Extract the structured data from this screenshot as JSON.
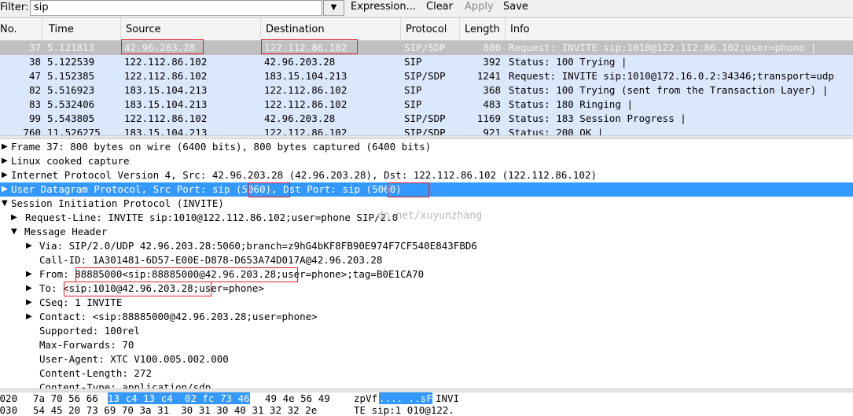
{
  "filter": {
    "label": "Filter:",
    "value": "sip",
    "expression_label": "Expression...",
    "clear_label": "Clear",
    "apply_label": "Apply",
    "save_label": "Save"
  },
  "columns": [
    "No.",
    "Time",
    "Source",
    "Destination",
    "Protocol",
    "Length",
    "Info"
  ],
  "packets": [
    {
      "no": "37",
      "time": "5.121813",
      "source": "42.96.203.28",
      "destination": "122.112.86.102",
      "protocol": "SIP/SDP",
      "length": "800",
      "info": "Request: INVITE sip:1010@122.112.86.102;user=phone |"
    },
    {
      "no": "38",
      "time": "5.122539",
      "source": "122.112.86.102",
      "destination": "42.96.203.28",
      "protocol": "SIP",
      "length": "392",
      "info": "Status: 100 Trying |"
    },
    {
      "no": "47",
      "time": "5.152385",
      "source": "122.112.86.102",
      "destination": "183.15.104.213",
      "protocol": "SIP/SDP",
      "length": "1241",
      "info": "Request: INVITE sip:1010@172.16.0.2:34346;transport=udp"
    },
    {
      "no": "82",
      "time": "5.516923",
      "source": "183.15.104.213",
      "destination": "122.112.86.102",
      "protocol": "SIP",
      "length": "368",
      "info": "Status: 100 Trying (sent from the Transaction Layer) |"
    },
    {
      "no": "83",
      "time": "5.532406",
      "source": "183.15.104.213",
      "destination": "122.112.86.102",
      "protocol": "SIP",
      "length": "483",
      "info": "Status: 180 Ringing |"
    },
    {
      "no": "99",
      "time": "5.543805",
      "source": "122.112.86.102",
      "destination": "42.96.203.28",
      "protocol": "SIP/SDP",
      "length": "1169",
      "info": "Status: 183 Session Progress |"
    },
    {
      "no": "760",
      "time": "11.526275",
      "source": "183.15.104.213",
      "destination": "122.112.86.102",
      "protocol": "SIP/SDP",
      "length": "921",
      "info": "Status: 200 OK |"
    }
  ],
  "tree": {
    "frame": "Frame 37: 800 bytes on wire (6400 bits), 800 bytes captured (6400 bits)",
    "linux": "Linux cooked capture",
    "ip": "Internet Protocol Version 4, Src: 42.96.203.28 (42.96.203.28), Dst: 122.112.86.102 (122.112.86.102)",
    "udp": "User Datagram Protocol, Src Port: sip (5060), Dst Port: sip (5060)",
    "sip": "Session Initiation Protocol (INVITE)",
    "request_line": "Request-Line: INVITE sip:1010@122.112.86.102;user=phone SIP/2.0",
    "message_header": "Message Header",
    "via": "Via: SIP/2.0/UDP 42.96.203.28:5060;branch=z9hG4bKF8FB90E974F7CF540E843FBD6",
    "call_id": "Call-ID: 1A301481-6D57-E00E-D878-D653A74D017A@42.96.203.28",
    "from": "From: 88885000<sip:88885000@42.96.203.28;user=phone>;tag=B0E1CA70",
    "to": "To: <sip:1010@42.96.203.28;user=phone>",
    "cseq": "CSeq: 1 INVITE",
    "contact": "Contact: <sip:88885000@42.96.203.28;user=phone>",
    "supported": "Supported: 100rel",
    "max_forwards": "Max-Forwards: 70",
    "user_agent": "User-Agent: XTC V100.005.002.000",
    "content_length": "Content-Length: 272",
    "content_type": "Content-Type: application/sdp"
  },
  "watermark": "dn.net/xuyunzhang",
  "hex": {
    "line1_offset": "0020",
    "line1_pre": "7a 70 56 66",
    "line1_sel": "13 c4 13 c4  02 fc 73 46",
    "line1_post": "49 4e 56 49",
    "line1_ascii_pre": "zpVf",
    "line1_ascii_sel": ".... ..sF",
    "line1_ascii_post": "INVI",
    "line2_offset": "0030",
    "line2_hex": "54 45 20 73 69 70 3a 31  30 31 30 40 31 32 32 2e",
    "line2_ascii": "TE sip:1 010@122."
  }
}
